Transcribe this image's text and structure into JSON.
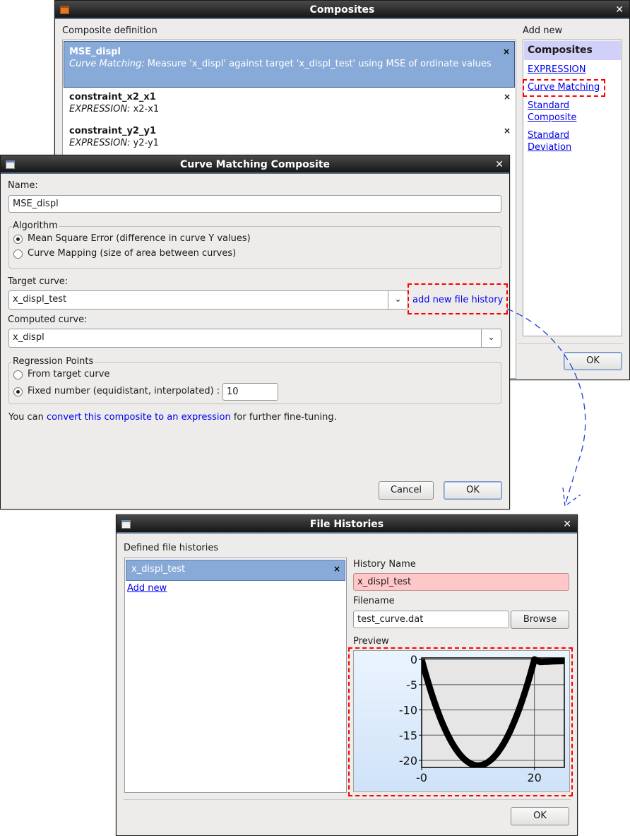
{
  "composites_window": {
    "title": "Composites",
    "definition_label": "Composite definition",
    "items": [
      {
        "name": "MSE_displ",
        "type": "Curve Matching:",
        "desc": " Measure 'x_displ' against target 'x_displ_test' using MSE of ordinate values",
        "selected": true
      },
      {
        "name": "constraint_x2_x1",
        "type": "EXPRESSION:",
        "desc": " x2-x1"
      },
      {
        "name": "constraint_y2_y1",
        "type": "EXPRESSION:",
        "desc": " y2-y1"
      }
    ],
    "add_new_label": "Add new",
    "add_new_header": "Composites",
    "add_new_links": [
      "EXPRESSION",
      "Curve Matching",
      "Standard Composite",
      "Standard Deviation"
    ],
    "ok_label": "OK",
    "delete_glyph": "×"
  },
  "curve_window": {
    "title": "Curve Matching Composite",
    "name_label": "Name:",
    "name_value": "MSE_displ",
    "algorithm_label": "Algorithm",
    "algorithm_options": [
      "Mean Square Error (difference in curve Y values)",
      "Curve Mapping (size of area between curves)"
    ],
    "algorithm_selected": 0,
    "target_label": "Target curve:",
    "target_value": "x_displ_test",
    "add_history_link": "add new file history",
    "computed_label": "Computed curve:",
    "computed_value": "x_displ",
    "regression_label": "Regression Points",
    "regression_options": [
      "From target curve",
      "Fixed number (equidistant, interpolated) :"
    ],
    "regression_selected": 1,
    "fixed_number": "10",
    "note_prefix": "You can ",
    "note_link": "convert this composite to an expression",
    "note_suffix": " for further fine-tuning.",
    "cancel_label": "Cancel",
    "ok_label": "OK"
  },
  "histories_window": {
    "title": "File Histories",
    "defined_label": "Defined file histories",
    "items": [
      "x_displ_test"
    ],
    "add_new_link": "Add new",
    "history_name_label": "History Name",
    "history_name_value": "x_displ_test",
    "filename_label": "Filename",
    "filename_value": "test_curve.dat",
    "browse_label": "Browse",
    "preview_label": "Preview",
    "ok_label": "OK",
    "history_name_bg": "#ffc8c8"
  },
  "chart_data": {
    "type": "line",
    "x": [
      0,
      2,
      4,
      6,
      8,
      10,
      12,
      14,
      16,
      18,
      20,
      21,
      23,
      25.3
    ],
    "y": [
      0,
      -7.6,
      -13.4,
      -17.6,
      -20.2,
      -21,
      -20.2,
      -17.6,
      -13.4,
      -7.6,
      0,
      -0.5,
      -0.4,
      -0.3
    ],
    "xticks": [
      "-0",
      "20"
    ],
    "xtick_values": [
      0,
      20
    ],
    "yticks": [
      "0",
      "-5",
      "-10",
      "-15",
      "-20"
    ],
    "ytick_values": [
      0,
      -5,
      -10,
      -15,
      -20
    ],
    "xlim": [
      0,
      25.3
    ],
    "ylim": [
      -21.4,
      0.3
    ],
    "grid": true,
    "line_color": "#000000"
  },
  "colors": {
    "selection": "#88aad8",
    "link": "#0000ee",
    "highlight": "#ff0000",
    "header": "#d0d0f8"
  }
}
